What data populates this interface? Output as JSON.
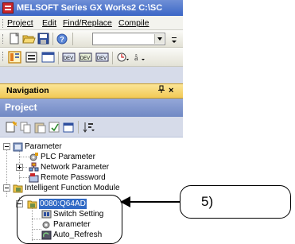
{
  "window": {
    "title": "MELSOFT Series GX Works2 C:\\SC"
  },
  "menu": [
    {
      "label": "Project"
    },
    {
      "label": "Edit"
    },
    {
      "label": "Find/Replace"
    },
    {
      "label": "Compile"
    }
  ],
  "toolbar1": {
    "buttons": [
      "new-icon",
      "open-icon",
      "save-icon",
      "help-icon"
    ],
    "combo_value": ""
  },
  "toolbar2": {
    "buttons": [
      "navigation-icon",
      "parameter-icon",
      "window-icon",
      "device-icon",
      "device-monitor-icon",
      "device-batch-icon",
      "watch-icon",
      "read-icon"
    ]
  },
  "navigation": {
    "title": "Navigation",
    "pin": "p",
    "close": "×"
  },
  "project": {
    "title": "Project",
    "toolbar": [
      "new-data-icon",
      "copy-icon",
      "paste-icon",
      "property-icon",
      "open-icon",
      "sort-icon"
    ]
  },
  "tree": [
    {
      "label": "Parameter",
      "icon": "parameter-folder-icon",
      "expanded": true
    },
    {
      "label": "PLC Parameter",
      "icon": "plc-parameter-icon"
    },
    {
      "label": "Network Parameter",
      "icon": "network-parameter-icon",
      "expanded": false
    },
    {
      "label": "Remote Password",
      "icon": "remote-password-icon"
    },
    {
      "label": "Intelligent Function Module",
      "icon": "intelligent-module-folder-icon",
      "expanded": true
    },
    {
      "label": "0080:Q64AD",
      "icon": "module-icon",
      "expanded": true,
      "selected": true
    },
    {
      "label": "Switch Setting",
      "icon": "switch-setting-icon"
    },
    {
      "label": "Parameter",
      "icon": "module-parameter-icon"
    },
    {
      "label": "Auto_Refresh",
      "icon": "auto-refresh-icon"
    }
  ],
  "callout": {
    "label": "5)"
  },
  "colors": {
    "title_bar": "#3b66c6",
    "nav_header": "#f2c956",
    "project_header": "#7189c4",
    "selection": "#316ac5"
  }
}
